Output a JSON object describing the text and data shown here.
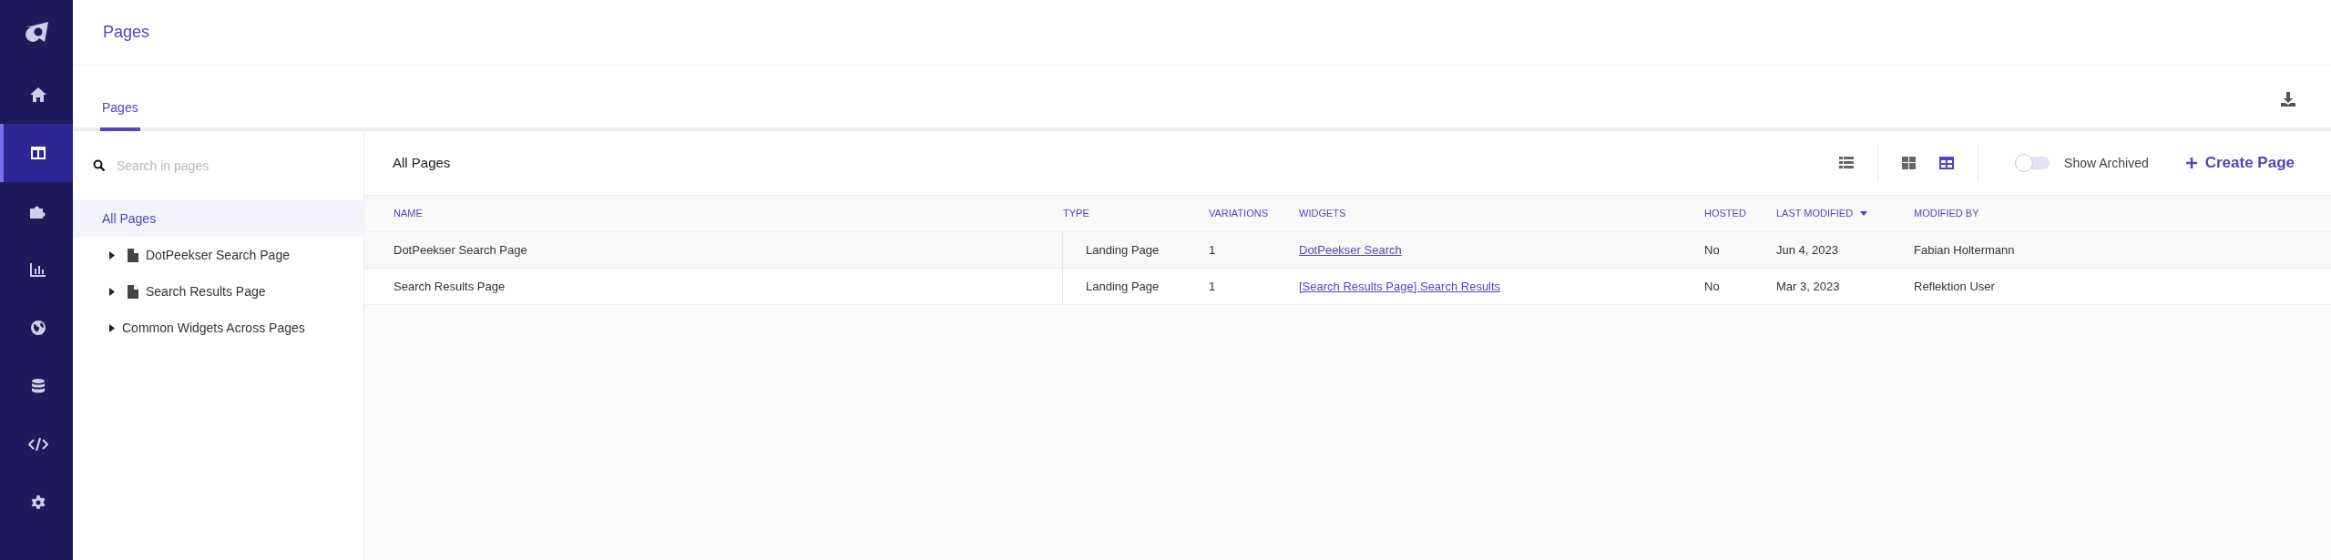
{
  "nav": [
    {
      "kind": "logo"
    },
    {
      "kind": "home",
      "selected": false
    },
    {
      "kind": "pages",
      "selected": true
    },
    {
      "kind": "puzzle",
      "selected": false
    },
    {
      "kind": "chart",
      "selected": false
    },
    {
      "kind": "globe",
      "selected": false
    },
    {
      "kind": "database",
      "selected": false
    },
    {
      "kind": "code",
      "selected": false
    },
    {
      "kind": "settings",
      "selected": false
    }
  ],
  "header": {
    "title": "Pages"
  },
  "tabs": [
    {
      "label": "Pages",
      "selected": true
    }
  ],
  "search": {
    "placeholder": "Search in pages"
  },
  "tree": [
    {
      "label": "All Pages",
      "selected": true,
      "kind": "root"
    },
    {
      "label": "DotPeekser Search Page",
      "selected": false,
      "kind": "page",
      "expanded": false
    },
    {
      "label": "Search Results Page",
      "selected": false,
      "kind": "page",
      "expanded": false
    },
    {
      "label": "Common Widgets Across Pages",
      "selected": false,
      "kind": "folder",
      "expanded": false
    }
  ],
  "panel": {
    "title": "All Pages",
    "views": [
      {
        "kind": "list",
        "selected": false
      },
      {
        "kind": "grid",
        "selected": false
      },
      {
        "kind": "table",
        "selected": true
      }
    ],
    "show_archived": {
      "label": "Show Archived",
      "on": false
    },
    "create_button": "Create Page"
  },
  "table": {
    "columns": [
      {
        "label": "NAME",
        "sorted": false
      },
      {
        "label": "TYPE",
        "sorted": false
      },
      {
        "label": "VARIATIONS",
        "sorted": false
      },
      {
        "label": "WIDGETS",
        "sorted": false
      },
      {
        "label": "HOSTED",
        "sorted": false
      },
      {
        "label": "LAST MODIFIED",
        "sorted": true
      },
      {
        "label": "MODIFIED BY",
        "sorted": false
      }
    ],
    "rows": [
      [
        "DotPeekser Search Page",
        "Landing Page",
        "1",
        "DotPeekser Search",
        "No",
        "Jun 4, 2023",
        "Fabian Holtermann"
      ],
      [
        "Search Results Page",
        "Landing Page",
        "1",
        "[Search Results Page] Search Results",
        "No",
        "Mar 3, 2023",
        "Reflektion User"
      ]
    ]
  }
}
